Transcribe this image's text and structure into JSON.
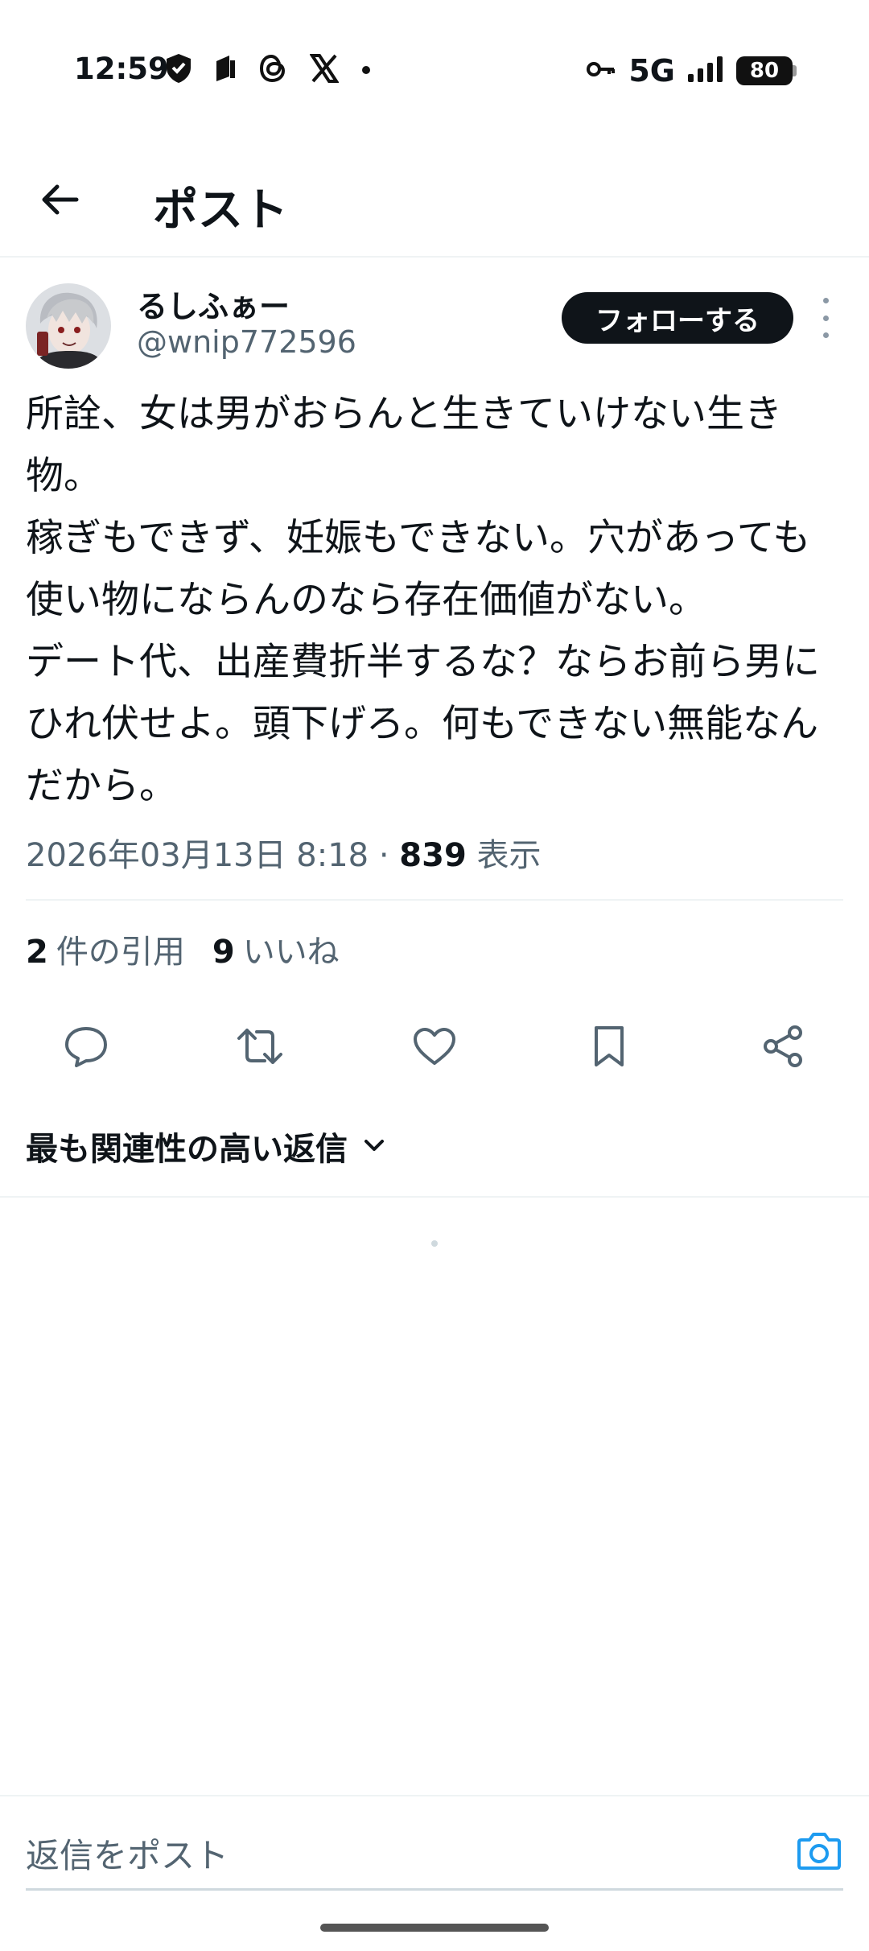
{
  "status_bar": {
    "time": "12:59",
    "network": "5G",
    "battery": "80",
    "left_icons": [
      "shield-icon",
      "notification-icon",
      "threads-icon",
      "x-icon",
      "dot-icon"
    ],
    "right_icons": [
      "key-icon",
      "signal-icon",
      "battery-icon"
    ]
  },
  "header": {
    "title": "ポスト"
  },
  "post": {
    "author_name": "るしふぁー",
    "author_handle": "@wnip772596",
    "follow_label": "フォローする",
    "text": "所詮、女は男がおらんと生きていけない生き物。\n稼ぎもできず、妊娠もできない。穴があっても使い物にならんのなら存在価値がない。\nデート代、出産費折半するな？ならお前ら男にひれ伏せよ。頭下げろ。何もできない無能なんだから。",
    "timestamp": "2026年03月13日 8:18",
    "separator": "·",
    "views_count": "839",
    "views_label": "表示",
    "quotes_count": "2",
    "quotes_label": "件の引用",
    "likes_count": "9",
    "likes_label": "いいね"
  },
  "replies": {
    "sort_label": "最も関連性の高い返信"
  },
  "composer": {
    "placeholder": "返信をポスト"
  },
  "colors": {
    "text_primary": "#0f1419",
    "text_secondary": "#536471",
    "accent": "#1d9bf0",
    "border": "#eff3f4"
  }
}
